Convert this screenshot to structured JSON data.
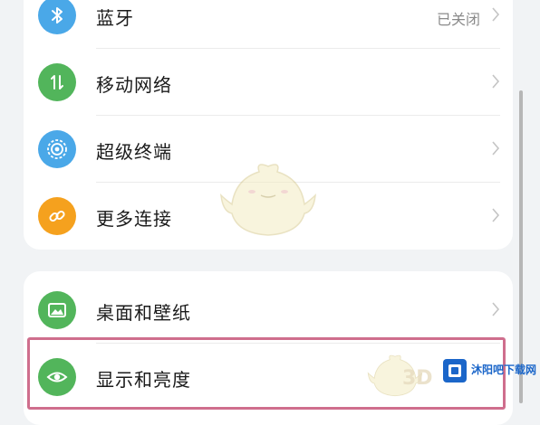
{
  "group1": [
    {
      "label": "蓝牙",
      "value": "已关闭",
      "icon": "bluetooth-icon",
      "color": "#4aa8e8"
    },
    {
      "label": "移动网络",
      "value": "",
      "icon": "mobile-data-icon",
      "color": "#52b55b"
    },
    {
      "label": "超级终端",
      "value": "",
      "icon": "super-device-icon",
      "color": "#4aa8e8"
    },
    {
      "label": "更多连接",
      "value": "",
      "icon": "link-icon",
      "color": "#f5a11e"
    }
  ],
  "group2": [
    {
      "label": "桌面和壁纸",
      "value": "",
      "icon": "wallpaper-icon",
      "color": "#52b55b"
    },
    {
      "label": "显示和亮度",
      "value": "",
      "icon": "eye-icon",
      "color": "#52b55b"
    }
  ],
  "watermark": {
    "logo": "3D",
    "text": "沐阳吧下载网"
  }
}
